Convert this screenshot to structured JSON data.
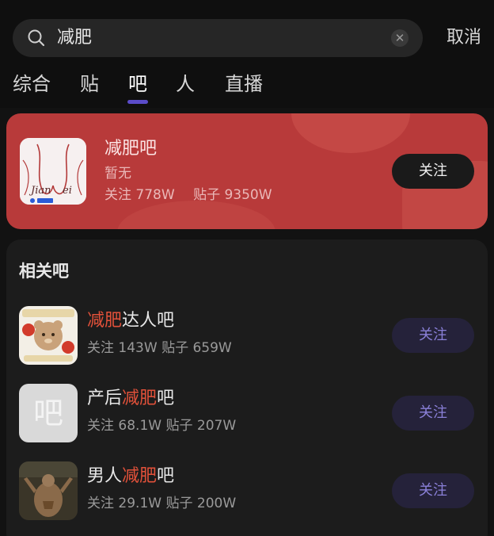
{
  "search": {
    "query": "减肥",
    "cancel_label": "取消"
  },
  "tabs": [
    {
      "label": "综合"
    },
    {
      "label": "贴"
    },
    {
      "label": "吧"
    },
    {
      "label": "人"
    },
    {
      "label": "直播"
    }
  ],
  "active_tab": "吧",
  "featured": {
    "name": "减肥吧",
    "description": "暂无",
    "follow_stat": "关注 778W",
    "post_stat": "贴子 9350W",
    "follow_label": "关注"
  },
  "related": {
    "title": "相关吧",
    "items": [
      {
        "prefix": "",
        "highlight": "减肥",
        "suffix": "达人吧",
        "stats": "关注 143W 贴子 659W",
        "follow_label": "关注",
        "avatar": "bear-mascot-icon"
      },
      {
        "prefix": "产后",
        "highlight": "减肥",
        "suffix": "吧",
        "stats": "关注 68.1W 贴子 207W",
        "follow_label": "关注",
        "avatar": "default-ba-icon",
        "avatar_char": "吧"
      },
      {
        "prefix": "男人",
        "highlight": "减肥",
        "suffix": "吧",
        "stats": "关注 29.1W 贴子 200W",
        "follow_label": "关注",
        "avatar": "muscle-man-icon"
      }
    ]
  },
  "colors": {
    "featured_bg": "#b83a3a",
    "highlight": "#e2513a",
    "accent": "#5b4cc9"
  }
}
